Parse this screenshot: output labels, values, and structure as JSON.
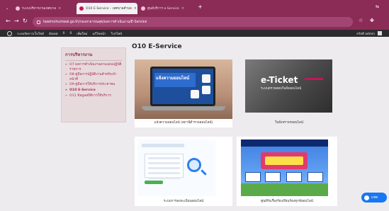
{
  "browser": {
    "tabs": [
      {
        "label": "ระบบบริหารงานเทศบาล",
        "active": false
      },
      {
        "label": "O10 E-Service – เทศบาลตำบล",
        "active": true
      },
      {
        "label": "ศูนย์บริการ e-Service",
        "active": false
      }
    ],
    "url": "tawimchumwai.go.th/กองสาธารณสุข/ผลการดำเนินงาน/E-Service",
    "wp_toolbar": {
      "site": "ระบบจัดการเว็บไซต์",
      "items": [
        "อัปเดต",
        "0",
        "0",
        "เพิ่มใหม่",
        "แก้ไขหน้า",
        "โปรไฟล์"
      ],
      "user": "สวัสดี admin"
    }
  },
  "sidebar": {
    "title": "การบริหารงาน",
    "items": [
      "O7 ผลการดำเนินงานตามแผนปฏิบัติราชการ",
      "O8 คู่มือการปฏิบัติงานสำหรับเจ้าหน้าที่",
      "O9 คู่มือการให้บริการประชาชน",
      "O10 E-Service",
      "O11 ข้อมูลสถิติการให้บริการ"
    ],
    "current_index": 3
  },
  "main": {
    "title": "O10 E-Service",
    "cards": [
      {
        "caption": "แจ้งความออนไลน์ (สถานีตำรวจออนไลน์)",
        "banner": "แจ้งความออนไลน์"
      },
      {
        "caption": "ใบสั่งจราจรออนไลน์",
        "title": "e-Ticket",
        "subtitle": "ระบบตรวจสอบใบสั่งออนไลน์"
      },
      {
        "caption": "ระบบการลงทะเบียนออนไลน์"
      },
      {
        "caption": "ศูนย์รับเรื่องร้องเรียนร้องทุกข์ออนไลน์"
      }
    ]
  },
  "chat": {
    "label": "แชท"
  }
}
